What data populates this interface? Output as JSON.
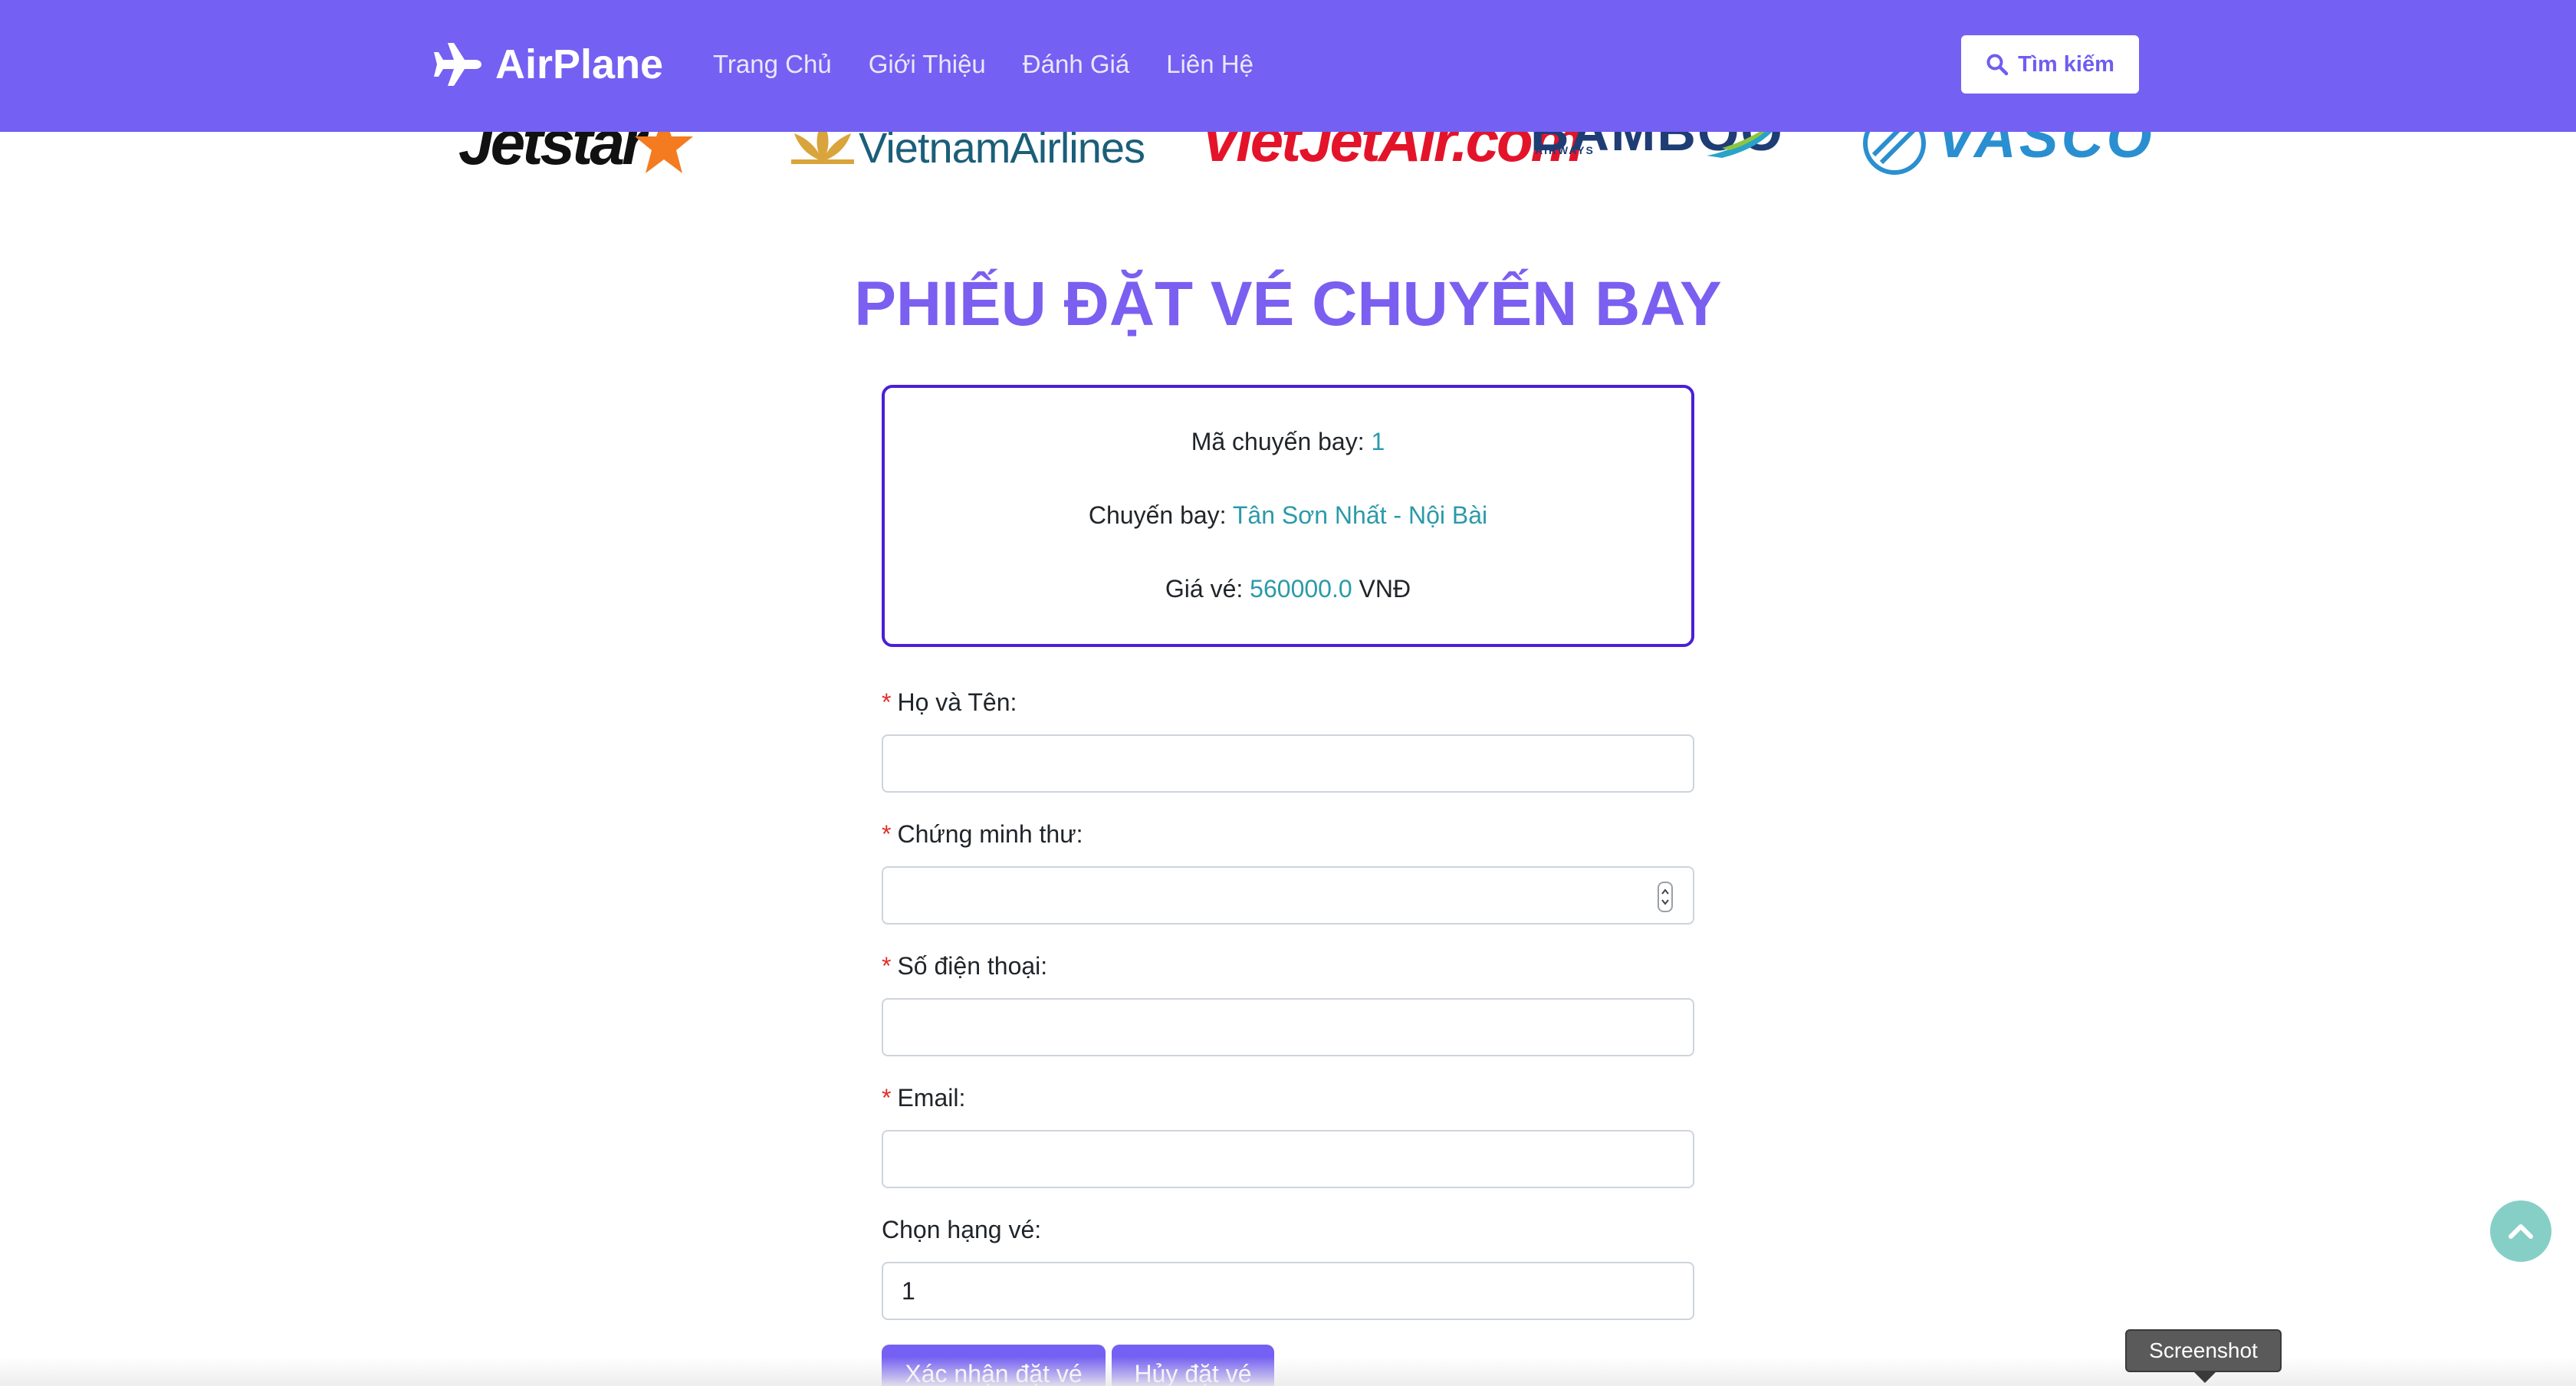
{
  "navbar": {
    "brand": "AirPlane",
    "links": [
      "Trang Chủ",
      "Giới Thiệu",
      "Đánh Giá",
      "Liên Hệ"
    ],
    "search_label": "Tìm kiếm"
  },
  "partners": [
    {
      "name": "Jetstar",
      "text": "Jetstar"
    },
    {
      "name": "Vietnam Airlines",
      "text": "VietnamAirlines"
    },
    {
      "name": "VietJet Air",
      "text": "VietJetAir.com"
    },
    {
      "name": "Bamboo Airways",
      "text": "BAMBOO",
      "sub": "AIRWAYS"
    },
    {
      "name": "VASCO",
      "text": "VASCO"
    }
  ],
  "form": {
    "title": "PHIẾU ĐẶT VÉ CHUYẾN BAY",
    "info": {
      "flight_code_label": "Mã chuyến bay: ",
      "flight_code": "1",
      "route_label": "Chuyến bay: ",
      "route": "Tân Sơn Nhất - Nội Bài",
      "price_label": "Giá vé: ",
      "price": "560000.0",
      "currency": " VNĐ"
    },
    "required_mark": "*",
    "fields": {
      "name": {
        "label": "Họ và Tên:",
        "value": ""
      },
      "id_card": {
        "label": "Chứng minh thư:",
        "value": ""
      },
      "phone": {
        "label": "Số điện thoại:",
        "value": ""
      },
      "email": {
        "label": "Email:",
        "value": ""
      },
      "ticket_class": {
        "label": "Chọn hạng vé:",
        "value": "1"
      }
    },
    "confirm_label": "Xác nhận đặt vé",
    "cancel_label": "Hủy đặt vé"
  },
  "tooltip": "Screenshot",
  "colors": {
    "brand": "#7460f2",
    "title": "#7b5ff0",
    "info_border": "#4a1fd6",
    "value": "#2b9aa8",
    "required": "#e0302a",
    "scroll_top": "#86cfc7"
  }
}
